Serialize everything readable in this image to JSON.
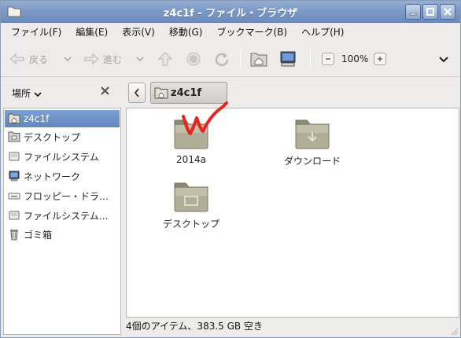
{
  "window": {
    "title": "z4c1f - ファイル・ブラウザ"
  },
  "menubar": {
    "items": [
      {
        "label": "ファイル(F)"
      },
      {
        "label": "編集(E)"
      },
      {
        "label": "表示(V)"
      },
      {
        "label": "移動(G)"
      },
      {
        "label": "ブックマーク(B)"
      },
      {
        "label": "ヘルプ(H)"
      }
    ]
  },
  "toolbar": {
    "back_label": "戻る",
    "forward_label": "進む",
    "zoom_level": "100%"
  },
  "sidebar": {
    "title": "場所",
    "items": [
      {
        "label": "z4c1f",
        "icon": "home-folder-icon",
        "selected": true
      },
      {
        "label": "デスクトップ",
        "icon": "desktop-folder-icon"
      },
      {
        "label": "ファイルシステム",
        "icon": "drive-icon"
      },
      {
        "label": "ネットワーク",
        "icon": "network-icon"
      },
      {
        "label": "フロッピー・ドラ…",
        "icon": "floppy-drive-icon"
      },
      {
        "label": "ファイルシステム…",
        "icon": "drive-icon"
      },
      {
        "label": "ゴミ箱",
        "icon": "trash-icon"
      }
    ]
  },
  "pathbar": {
    "current": "z4c1f"
  },
  "files": [
    {
      "name": "2014a",
      "icon": "folder-icon"
    },
    {
      "name": "ダウンロード",
      "icon": "downloads-folder-icon"
    },
    {
      "name": "デスクトップ",
      "icon": "desktop-folder-icon"
    }
  ],
  "status": {
    "text": "4個のアイテム、383.5 GB 空き"
  },
  "colors": {
    "titlebar": "#7b99c6",
    "selection": "#6a8fc8",
    "folder": "#a8a58c",
    "annotation": "#e8241c"
  }
}
